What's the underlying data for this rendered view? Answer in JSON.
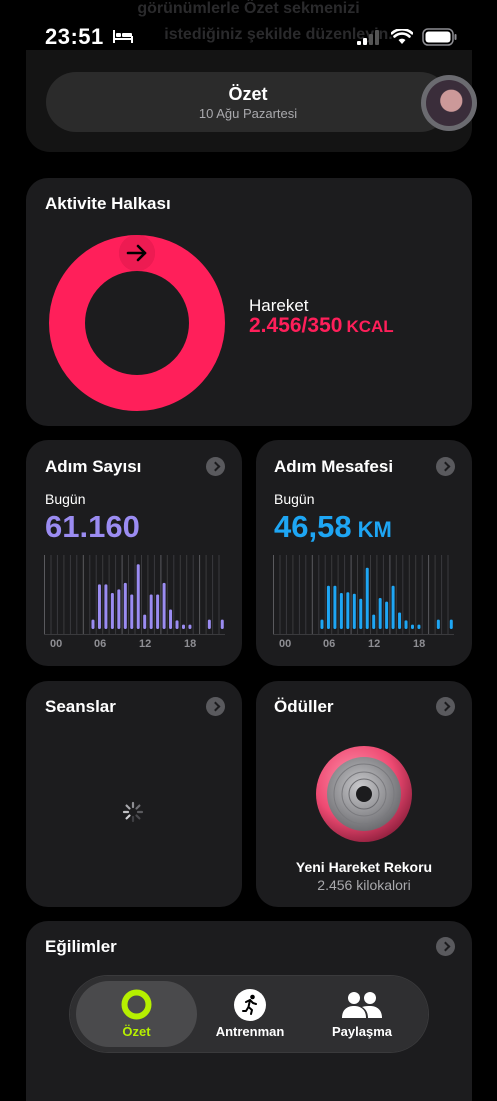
{
  "status_bar": {
    "time": "23:51",
    "sleep_icon": "bed-icon",
    "signal_icon": "cellular-signal-icon",
    "wifi_icon": "wifi-icon",
    "battery_icon": "battery-icon"
  },
  "background_text": {
    "line1": "görünümlerle Özet sekmenizi",
    "line2": "istediğiniz şekilde düzenleyin."
  },
  "header": {
    "title": "Özet",
    "subtitle": "10 Ağu Pazartesi"
  },
  "activity_ring": {
    "title": "Aktivite Halkası",
    "move_label": "Hareket",
    "move_value": "2.456/350",
    "move_unit": "KCAL",
    "ring_color": "#ff1f5a",
    "progress_fraction": 7.02
  },
  "steps": {
    "title": "Adım Sayısı",
    "period": "Bugün",
    "value": "61.160",
    "color": "#9b8cf2",
    "axis_labels": [
      "00",
      "06",
      "12",
      "18"
    ],
    "hourly_relative": [
      0,
      0,
      0,
      0,
      0,
      0,
      0,
      0.13,
      0.62,
      0.62,
      0.5,
      0.55,
      0.64,
      0.48,
      0.9,
      0.2,
      0.48,
      0.48,
      0.64,
      0.27,
      0.12,
      0.06,
      0.06,
      0,
      0,
      0.13,
      0,
      0.13
    ]
  },
  "distance": {
    "title": "Adım Mesafesi",
    "period": "Bugün",
    "value": "46,58",
    "unit": "KM",
    "color": "#1ea6f4",
    "axis_labels": [
      "00",
      "06",
      "12",
      "18"
    ],
    "hourly_relative": [
      0,
      0,
      0,
      0,
      0,
      0,
      0,
      0.13,
      0.6,
      0.6,
      0.5,
      0.51,
      0.49,
      0.42,
      0.85,
      0.2,
      0.43,
      0.38,
      0.6,
      0.23,
      0.12,
      0.06,
      0.06,
      0,
      0,
      0.13,
      0,
      0.13
    ]
  },
  "sessions": {
    "title": "Seanslar"
  },
  "awards": {
    "title": "Ödüller",
    "award_name": "Yeni Hareket Rekoru",
    "award_detail": "2.456 kilokalori"
  },
  "trends": {
    "title": "Eğilimler"
  },
  "tabbar": {
    "tabs": [
      {
        "label": "Özet",
        "icon": "activity-rings-icon",
        "active": true
      },
      {
        "label": "Antrenman",
        "icon": "running-figure-icon",
        "active": false
      },
      {
        "label": "Paylaşma",
        "icon": "people-icon",
        "active": false
      }
    ],
    "accent": "#b6f000"
  }
}
